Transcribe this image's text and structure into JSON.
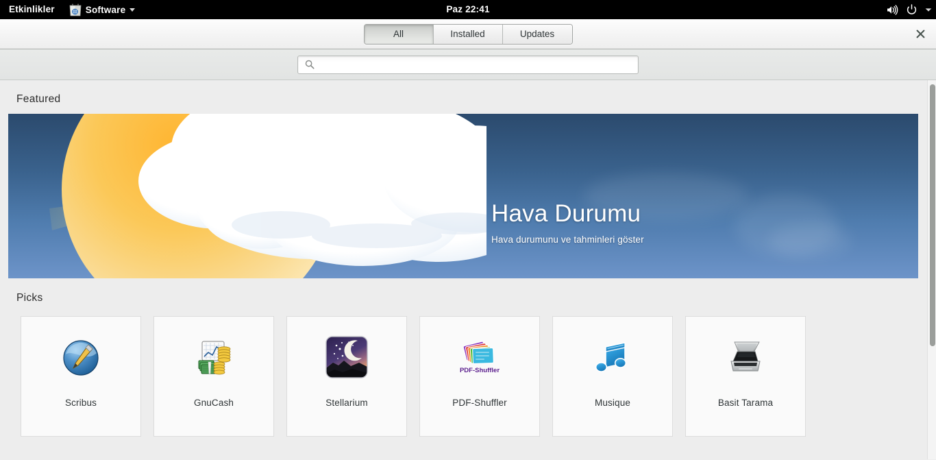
{
  "topbar": {
    "activities_label": "Etkinlikler",
    "app_menu_label": "Software",
    "app_menu_icon": "software-bag-icon",
    "clock": "Paz 22:41",
    "volume_icon": "volume-high-icon",
    "power_icon": "power-icon",
    "menu_caret_icon": "chevron-down-icon"
  },
  "window": {
    "close_label": "×",
    "tabs": [
      {
        "label": "All",
        "active": true
      },
      {
        "label": "Installed",
        "active": false
      },
      {
        "label": "Updates",
        "active": false
      }
    ],
    "search": {
      "value": "",
      "placeholder": "",
      "icon": "search-icon"
    }
  },
  "content": {
    "featured_heading": "Featured",
    "featured_banner": {
      "title": "Hava Durumu",
      "subtitle": "Hava durumunu ve tahminleri göster",
      "artwork": "sun-behind-cloud-illustration",
      "sky_top_color": "#2b4a6d",
      "sky_bottom_color": "#6d94c9",
      "sun_color": "#f6c049",
      "cloud_color": "#ffffff"
    },
    "picks_heading": "Picks",
    "picks": [
      {
        "name": "Scribus",
        "icon": "scribus-icon"
      },
      {
        "name": "GnuCash",
        "icon": "gnucash-icon"
      },
      {
        "name": "Stellarium",
        "icon": "stellarium-icon"
      },
      {
        "name": "PDF-Shuffler",
        "icon": "pdf-shuffler-icon",
        "icon_text": "PDF-Shuffler"
      },
      {
        "name": "Musique",
        "icon": "musique-icon"
      },
      {
        "name": "Basit Tarama",
        "icon": "simple-scan-icon"
      }
    ]
  },
  "theme": {
    "page_background": "#ededed",
    "card_background": "#fafafa",
    "card_border": "#dcdcdc",
    "text_color": "#2e3436",
    "topbar_background": "#000000",
    "scrollbar_thumb": "#9b9e9b"
  }
}
